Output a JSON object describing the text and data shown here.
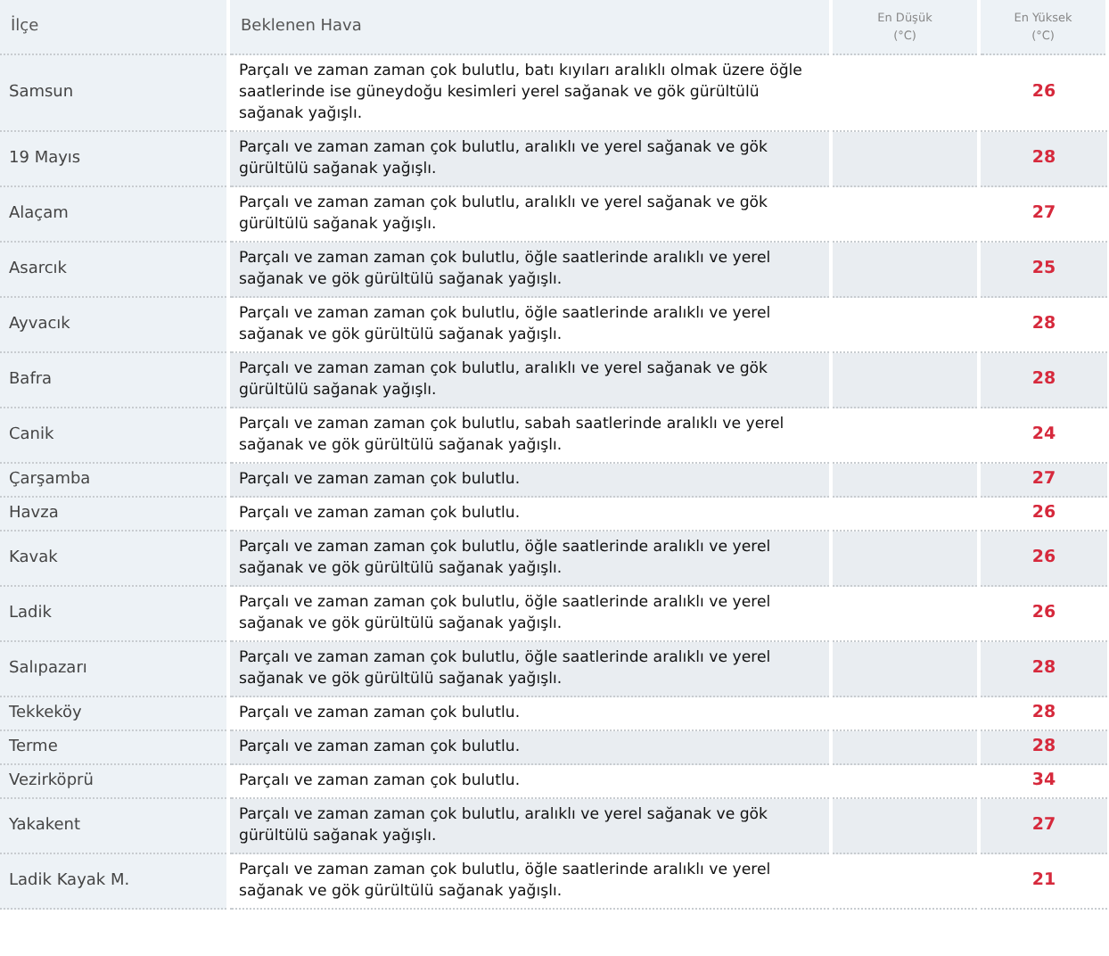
{
  "table": {
    "columns": [
      {
        "label": "İlçe"
      },
      {
        "label": "Beklenen Hava"
      },
      {
        "label": "En Düşük",
        "unit": "(°C)"
      },
      {
        "label": "En Yüksek",
        "unit": "(°C)"
      }
    ],
    "rows": [
      {
        "district": "Samsun",
        "forecast": "Parçalı ve zaman zaman çok bulutlu, batı kıyıları aralıklı olmak üzere öğle saatlerinde ise güneydoğu kesimleri yerel sağanak ve gök gürültülü sağanak yağışlı.",
        "max": "26"
      },
      {
        "district": "19 Mayıs",
        "forecast": "Parçalı ve zaman zaman çok bulutlu, aralıklı ve yerel sağanak ve gök gürültülü sağanak yağışlı.",
        "max": "28"
      },
      {
        "district": "Alaçam",
        "forecast": "Parçalı ve zaman zaman çok bulutlu, aralıklı ve yerel sağanak ve gök gürültülü sağanak yağışlı.",
        "max": "27"
      },
      {
        "district": "Asarcık",
        "forecast": "Parçalı ve zaman zaman çok bulutlu, öğle saatlerinde aralıklı ve yerel sağanak ve gök gürültülü sağanak yağışlı.",
        "max": "25"
      },
      {
        "district": "Ayvacık",
        "forecast": "Parçalı ve zaman zaman çok bulutlu, öğle saatlerinde aralıklı ve yerel sağanak ve gök gürültülü sağanak yağışlı.",
        "max": "28"
      },
      {
        "district": "Bafra",
        "forecast": "Parçalı ve zaman zaman çok bulutlu, aralıklı ve yerel sağanak ve gök gürültülü sağanak yağışlı.",
        "max": "28"
      },
      {
        "district": "Canik",
        "forecast": "Parçalı ve zaman zaman çok bulutlu, sabah saatlerinde aralıklı ve yerel sağanak ve gök gürültülü sağanak yağışlı.",
        "max": "24"
      },
      {
        "district": "Çarşamba",
        "forecast": "Parçalı ve zaman zaman çok bulutlu.",
        "max": "27"
      },
      {
        "district": "Havza",
        "forecast": "Parçalı ve zaman zaman çok bulutlu.",
        "max": "26"
      },
      {
        "district": "Kavak",
        "forecast": "Parçalı ve zaman zaman çok bulutlu, öğle saatlerinde aralıklı ve yerel sağanak ve gök gürültülü sağanak yağışlı.",
        "max": "26"
      },
      {
        "district": "Ladik",
        "forecast": "Parçalı ve zaman zaman çok bulutlu, öğle saatlerinde aralıklı ve yerel sağanak ve gök gürültülü sağanak yağışlı.",
        "max": "26"
      },
      {
        "district": "Salıpazarı",
        "forecast": "Parçalı ve zaman zaman çok bulutlu, öğle saatlerinde aralıklı ve yerel sağanak ve gök gürültülü sağanak yağışlı.",
        "max": "28"
      },
      {
        "district": "Tekkeköy",
        "forecast": "Parçalı ve zaman zaman çok bulutlu.",
        "max": "28"
      },
      {
        "district": "Terme",
        "forecast": "Parçalı ve zaman zaman çok bulutlu.",
        "max": "28"
      },
      {
        "district": "Vezirköprü",
        "forecast": "Parçalı ve zaman zaman çok bulutlu.",
        "max": "34"
      },
      {
        "district": "Yakakent",
        "forecast": "Parçalı ve zaman zaman çok bulutlu, aralıklı ve yerel sağanak ve gök gürültülü sağanak yağışlı.",
        "max": "27"
      },
      {
        "district": "Ladik Kayak M.",
        "forecast": "Parçalı ve zaman zaman çok bulutlu, öğle saatlerinde aralıklı ve yerel sağanak ve gök gürültülü sağanak yağışlı.",
        "max": "21"
      }
    ]
  }
}
